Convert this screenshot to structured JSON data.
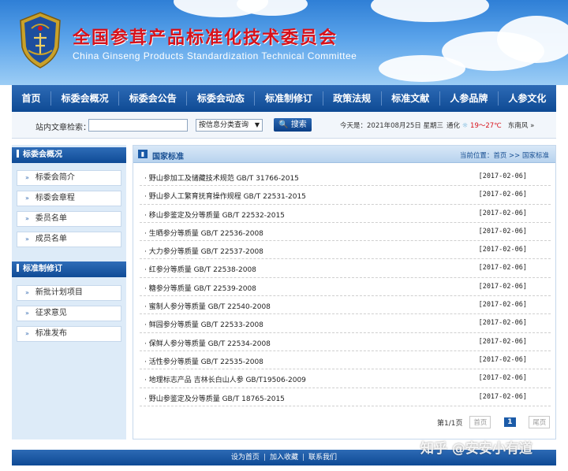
{
  "header": {
    "title_cn": "全国参茸产品标准化技术委员会",
    "title_en": "China Ginseng Products Standardization Technical Committee"
  },
  "nav": [
    "首页",
    "标委会概况",
    "标委会公告",
    "标委会动态",
    "标准制修订",
    "政策法规",
    "标准文献",
    "人参品牌",
    "人参文化"
  ],
  "search": {
    "label": "站内文章检索：",
    "value": "",
    "select": "按信息分类查询",
    "button": "搜索",
    "date": "今天是：2021年08月25日  星期三",
    "city": "通化",
    "temp": "19～27℃",
    "wind": "东南风"
  },
  "sidebar": {
    "group1_title": "标委会概况",
    "group1_items": [
      "标委会简介",
      "标委会章程",
      "委员名单",
      "成员名单"
    ],
    "group2_title": "标准制修订",
    "group2_items": [
      "新批计划项目",
      "征求意见",
      "标准发布"
    ]
  },
  "main": {
    "title": "国家标准",
    "breadcrumb": "当前位置：首页 >> 国家标准",
    "rows": [
      {
        "title": "· 野山参加工及储藏技术规范 GB/T 31766-2015",
        "date": "[2017-02-06]"
      },
      {
        "title": "· 野山参人工繁育抚育操作规程 GB/T 22531-2015",
        "date": "[2017-02-06]"
      },
      {
        "title": "· 移山参鉴定及分等质量 GB/T 22532-2015",
        "date": "[2017-02-06]"
      },
      {
        "title": "· 生晒参分等质量 GB/T 22536-2008",
        "date": "[2017-02-06]"
      },
      {
        "title": "· 大力参分等质量 GB/T 22537-2008",
        "date": "[2017-02-06]"
      },
      {
        "title": "· 红参分等质量 GB/T 22538-2008",
        "date": "[2017-02-06]"
      },
      {
        "title": "· 糖参分等质量 GB/T 22539-2008",
        "date": "[2017-02-06]"
      },
      {
        "title": "· 蜜制人参分等质量 GB/T 22540-2008",
        "date": "[2017-02-06]"
      },
      {
        "title": "· 鲜园参分等质量 GB/T 22533-2008",
        "date": "[2017-02-06]"
      },
      {
        "title": "· 保鲜人参分等质量 GB/T 22534-2008",
        "date": "[2017-02-06]"
      },
      {
        "title": "· 活性参分等质量 GB/T 22535-2008",
        "date": "[2017-02-06]"
      },
      {
        "title": "· 地理标志产品 吉林长白山人参 GB/T19506-2009",
        "date": "[2017-02-06]"
      },
      {
        "title": "· 野山参鉴定及分等质量 GB/T 18765-2015",
        "date": "[2017-02-06]"
      }
    ],
    "pager": {
      "info": "第1/1页",
      "first": "首页",
      "current": "1",
      "last": "尾页"
    }
  },
  "footer": {
    "links": [
      "设为首页",
      "加入收藏",
      "联系我们"
    ]
  },
  "watermark": "知乎 @安安小有道",
  "colors": {
    "primary": "#0e4a94",
    "title_red": "#d8121b",
    "sidebar_bg": "#ddebf8"
  }
}
